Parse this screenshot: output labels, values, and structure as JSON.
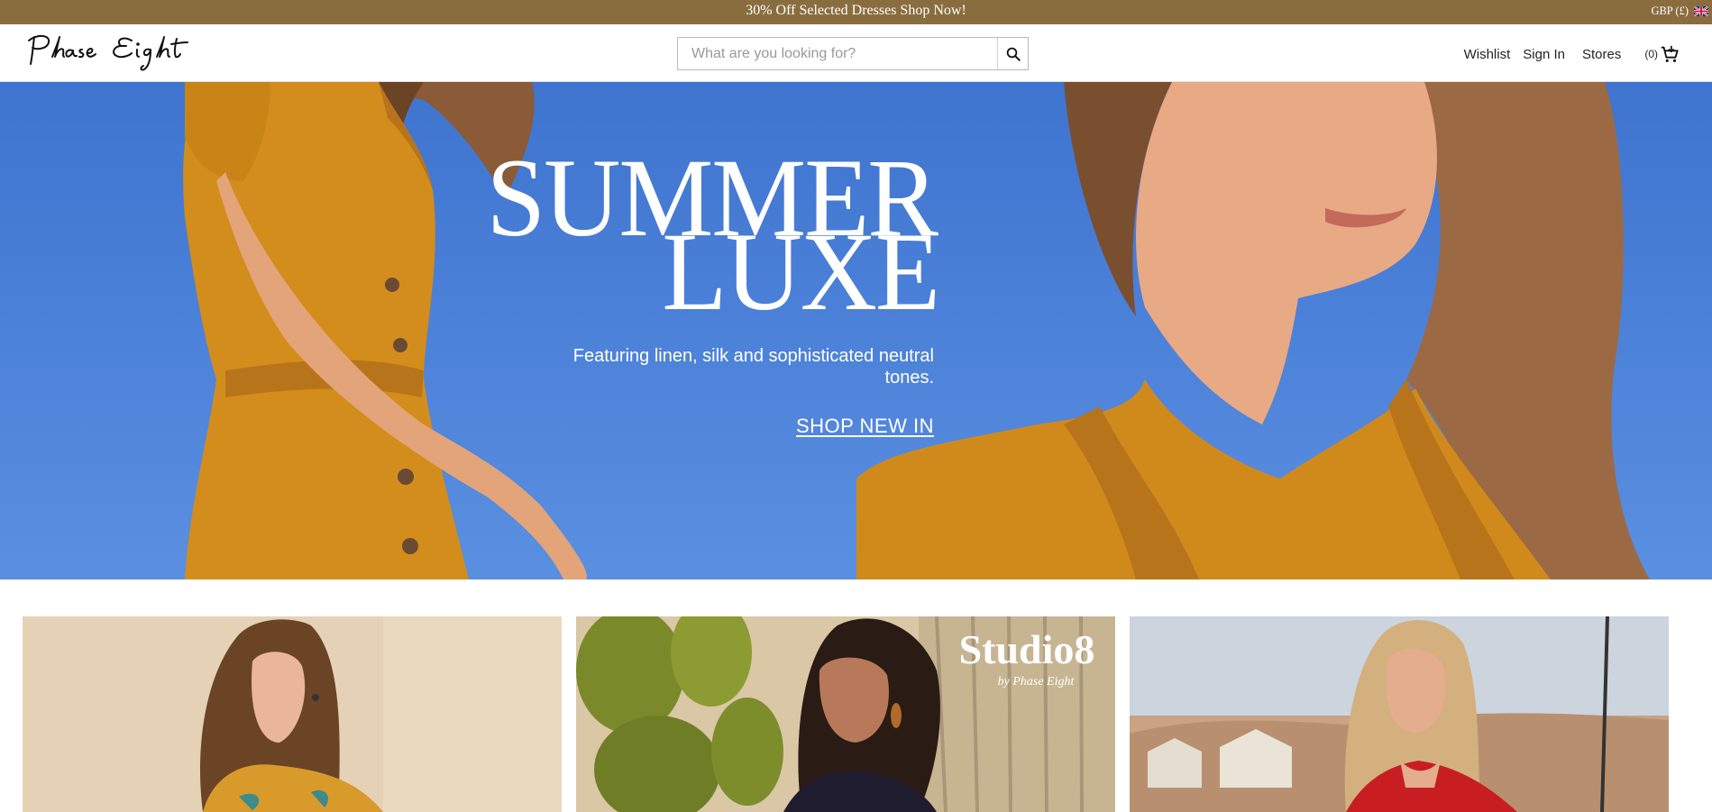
{
  "promo": {
    "text": "30% Off Selected Dresses Shop Now!",
    "currency": "GBP (£)",
    "flag_icon": "uk-flag-icon"
  },
  "header": {
    "logo_text": "Phase Eight",
    "search_placeholder": "What are you looking for?",
    "nav": {
      "wishlist": "Wishlist",
      "sign_in": "Sign In",
      "stores": "Stores",
      "cart_count": "(0)"
    }
  },
  "hero": {
    "title_line1": "SUMMER",
    "title_line2": "LUXE",
    "subtitle": "Featuring linen, silk and sophisticated neutral tones.",
    "cta": "SHOP NEW IN"
  },
  "tiles": [
    {
      "overlay_text": ""
    },
    {
      "overlay_text": "Studio8",
      "overlay_sub": "by Phase Eight"
    },
    {
      "overlay_text": ""
    }
  ],
  "colors": {
    "promo_bg": "#8a6d3f",
    "hero_blue": "#4b80d8",
    "mustard": "#d08a1c"
  }
}
